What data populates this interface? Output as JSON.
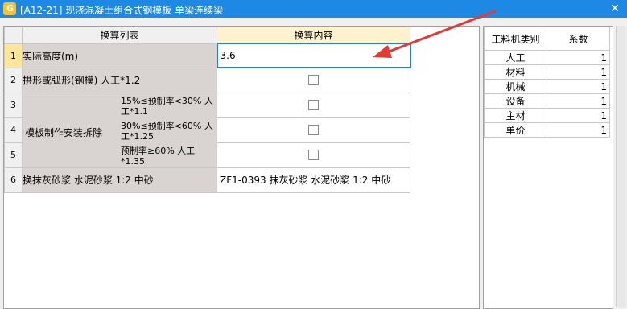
{
  "window": {
    "title": "[A12-21] 现浇混凝土组合式钢模板 单梁连续梁",
    "close_label": "✕"
  },
  "table": {
    "headers": [
      "换算列表",
      "换算内容"
    ],
    "rows": [
      {
        "num": "1",
        "name": "实际高度(m)",
        "value": "3.6"
      },
      {
        "num": "2",
        "name": "拱形或弧形(钢模) 人工*1.2",
        "value": ""
      },
      {
        "num": "3",
        "name": "",
        "value": ""
      },
      {
        "num": "4",
        "name": "",
        "value": ""
      },
      {
        "num": "5",
        "name": "",
        "value": ""
      },
      {
        "num": "6",
        "name": "换抹灰砂浆 水泥砂浆 1:2 中砂",
        "value": "ZF1-0393  抹灰砂浆 水泥砂浆 1:2 中砂"
      }
    ],
    "group": {
      "label": "模板制作安装拆除",
      "subs": [
        [
          "15%≤预制率<30% 人",
          "工*1.1"
        ],
        [
          "30%≤预制率<60% 人",
          "工*1.25"
        ],
        [
          "预制率≥60% 人工",
          "*1.35"
        ]
      ]
    }
  },
  "coefficients": {
    "headers": [
      "工料机类别",
      "系数"
    ],
    "rows": [
      {
        "category": "人工",
        "value": "1"
      },
      {
        "category": "材料",
        "value": "1"
      },
      {
        "category": "机械",
        "value": "1"
      },
      {
        "category": "设备",
        "value": "1"
      },
      {
        "category": "主材",
        "value": "1"
      },
      {
        "category": "单价",
        "value": "1"
      }
    ]
  },
  "colors": {
    "titlebar": "#1e88e5",
    "active_header": "#fff2cc",
    "name_cell": "#d9d4d1",
    "arrow": "#e53935"
  }
}
